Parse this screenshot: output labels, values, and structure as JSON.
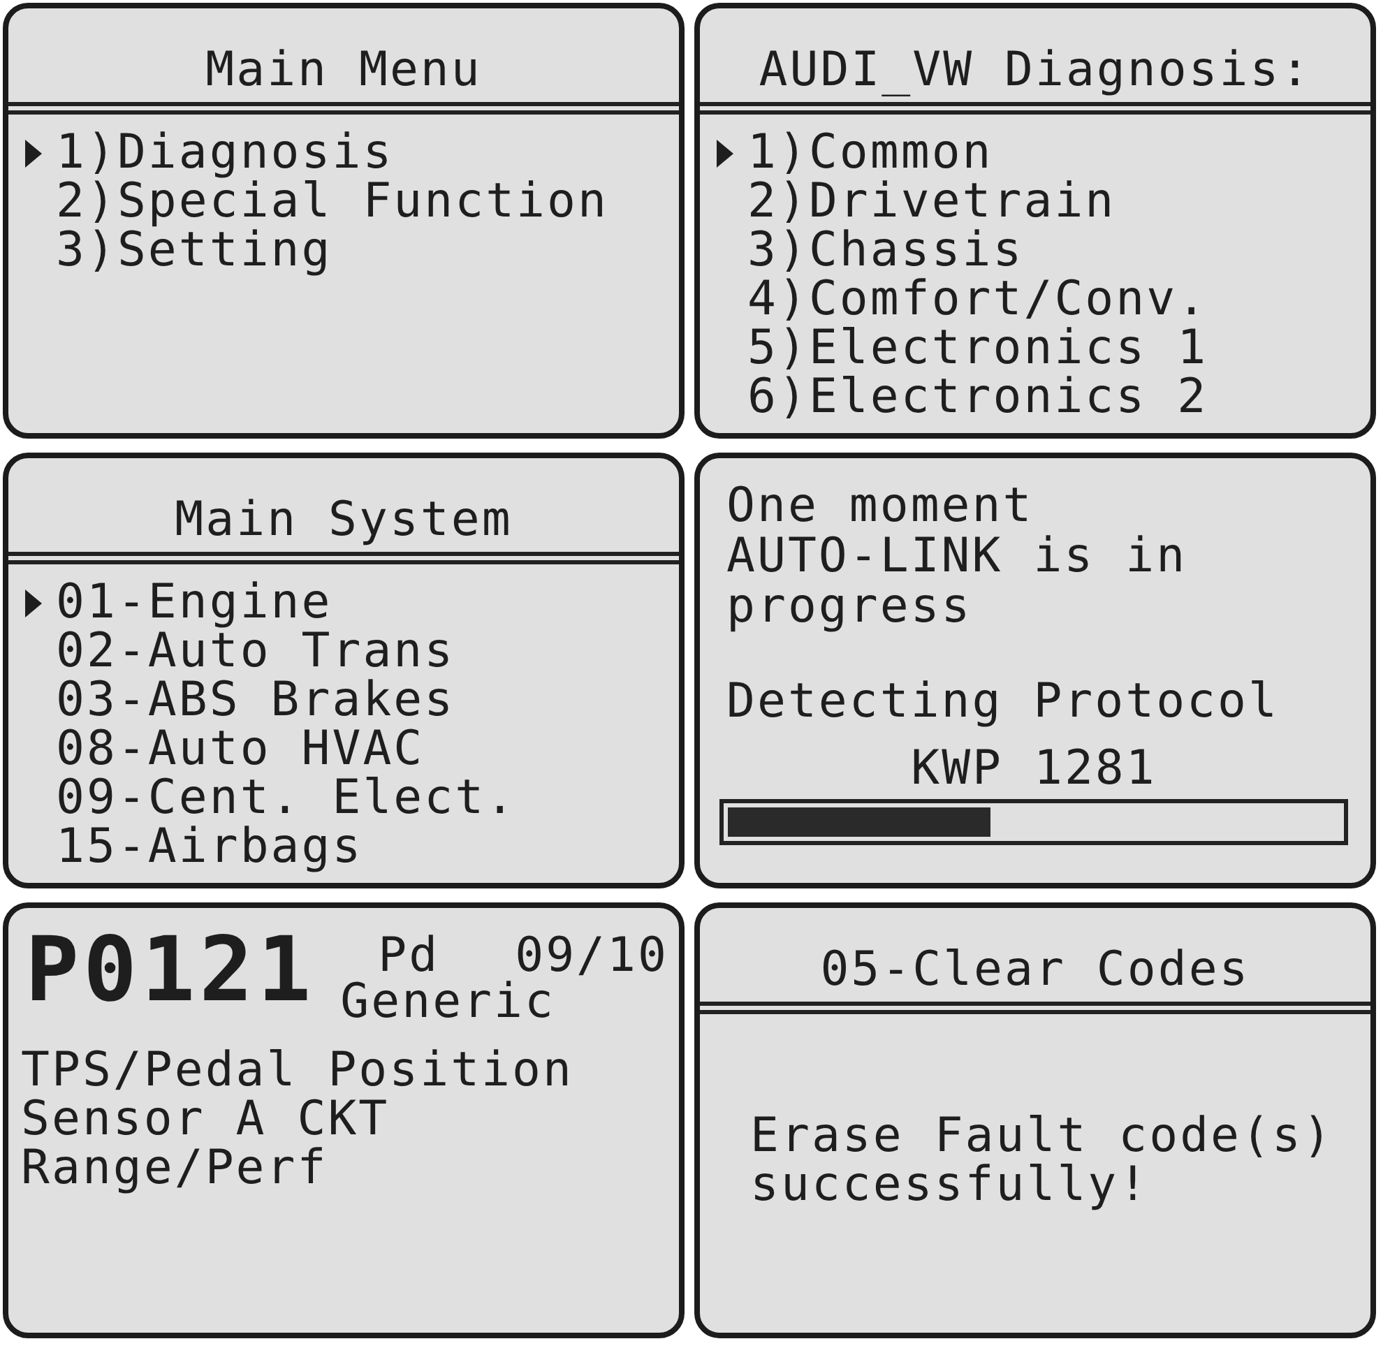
{
  "screens": [
    {
      "kind": "menu",
      "title": "Main Menu",
      "items": [
        {
          "label": "1)Diagnosis",
          "selected": true
        },
        {
          "label": "2)Special Function",
          "selected": false
        },
        {
          "label": "3)Setting",
          "selected": false
        }
      ]
    },
    {
      "kind": "menu",
      "title": "AUDI_VW Diagnosis:",
      "items": [
        {
          "label": "1)Common",
          "selected": true
        },
        {
          "label": "2)Drivetrain",
          "selected": false
        },
        {
          "label": "3)Chassis",
          "selected": false
        },
        {
          "label": "4)Comfort/Conv.",
          "selected": false
        },
        {
          "label": "5)Electronics 1",
          "selected": false
        },
        {
          "label": "6)Electronics 2",
          "selected": false
        }
      ]
    },
    {
      "kind": "menu",
      "title": "Main System",
      "items": [
        {
          "label": "01-Engine",
          "selected": true
        },
        {
          "label": "02-Auto Trans",
          "selected": false
        },
        {
          "label": "03-ABS Brakes",
          "selected": false
        },
        {
          "label": "08-Auto HVAC",
          "selected": false
        },
        {
          "label": "09-Cent. Elect.",
          "selected": false
        },
        {
          "label": "15-Airbags",
          "selected": false
        }
      ]
    },
    {
      "kind": "progress",
      "lines": [
        "One moment",
        "AUTO-LINK is in",
        "progress"
      ],
      "status": "Detecting Protocol",
      "protocol": "KWP 1281",
      "level": 0.43
    },
    {
      "kind": "code",
      "code": "P0121",
      "status": "Pd",
      "count": "09/10",
      "type": "Generic",
      "description": [
        "TPS/Pedal Position",
        "Sensor A CKT",
        "Range/Perf"
      ]
    },
    {
      "kind": "message",
      "title": "05-Clear Codes",
      "message": [
        "Erase Fault code(s)",
        "successfully!"
      ]
    }
  ]
}
